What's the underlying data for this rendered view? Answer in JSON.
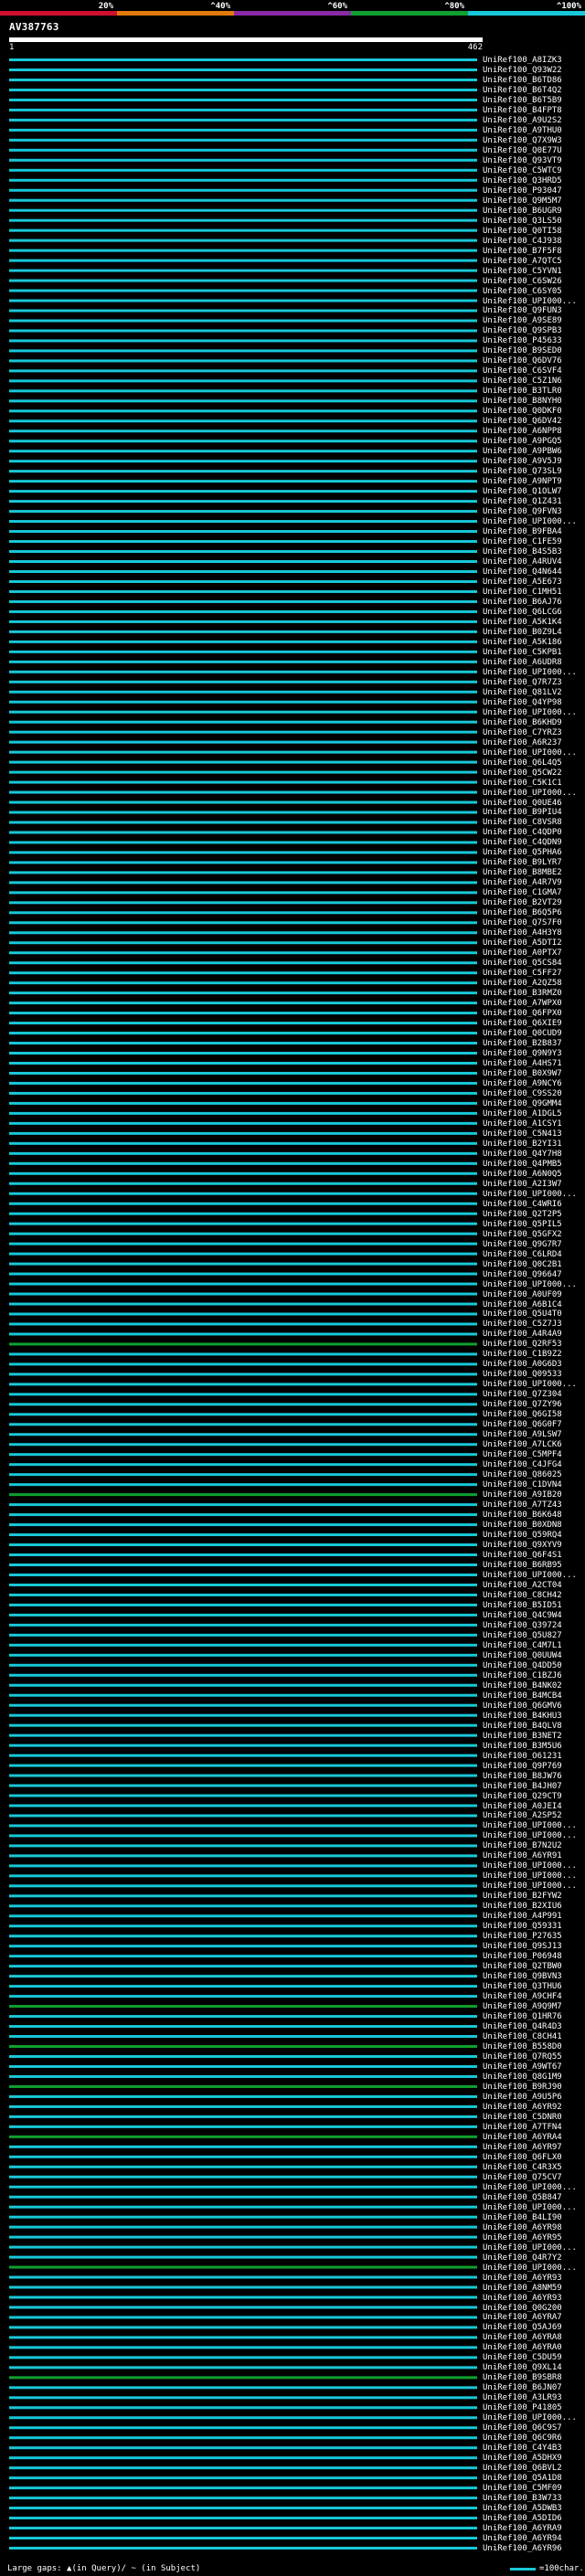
{
  "legend": {
    "segments": [
      {
        "label": "20%",
        "color": "#d0102e"
      },
      {
        "label": "^40%",
        "color": "#e07a0a"
      },
      {
        "label": "^60%",
        "color": "#8a2aa6"
      },
      {
        "label": "^80%",
        "color": "#10a030"
      },
      {
        "label": "^100%",
        "color": "#18c8d8"
      }
    ]
  },
  "query": {
    "title": "AV387763",
    "ruler_start": "1",
    "ruler_end": "462"
  },
  "hits": [
    {
      "label": "UniRef100_A8IZK3",
      "color": "#18c8d8"
    },
    {
      "label": "UniRef100_Q93W22",
      "color": "#18c8d8"
    },
    {
      "label": "UniRef100_B6TD86",
      "color": "#18c8d8"
    },
    {
      "label": "UniRef100_B6T4Q2",
      "color": "#18c8d8"
    },
    {
      "label": "UniRef100_B6T5B9",
      "color": "#18c8d8"
    },
    {
      "label": "UniRef100_B4FPT8",
      "color": "#18c8d8"
    },
    {
      "label": "UniRef100_A9U2S2",
      "color": "#18c8d8"
    },
    {
      "label": "UniRef100_A9THU0",
      "color": "#18c8d8"
    },
    {
      "label": "UniRef100_Q7X9W3",
      "color": "#18c8d8"
    },
    {
      "label": "UniRef100_Q0E77U",
      "color": "#18c8d8"
    },
    {
      "label": "UniRef100_Q93VT9",
      "color": "#18c8d8"
    },
    {
      "label": "UniRef100_C5WTC9",
      "color": "#18c8d8"
    },
    {
      "label": "UniRef100_Q3HRD5",
      "color": "#18c8d8"
    },
    {
      "label": "UniRef100_P93047",
      "color": "#18c8d8"
    },
    {
      "label": "UniRef100_Q9M5M7",
      "color": "#18c8d8"
    },
    {
      "label": "UniRef100_B6UGR9",
      "color": "#18c8d8"
    },
    {
      "label": "UniRef100_Q3LS50",
      "color": "#18c8d8"
    },
    {
      "label": "UniRef100_Q0TI58",
      "color": "#18c8d8"
    },
    {
      "label": "UniRef100_C4J938",
      "color": "#18c8d8"
    },
    {
      "label": "UniRef100_B7F5F8",
      "color": "#18c8d8"
    },
    {
      "label": "UniRef100_A7QTC5",
      "color": "#18c8d8"
    },
    {
      "label": "UniRef100_C5YVN1",
      "color": "#18c8d8"
    },
    {
      "label": "UniRef100_C6SW26",
      "color": "#18c8d8"
    },
    {
      "label": "UniRef100_C6SY05",
      "color": "#18c8d8"
    },
    {
      "label": "UniRef100_UPI000...",
      "color": "#18c8d8"
    },
    {
      "label": "UniRef100_Q9FUN3",
      "color": "#18c8d8"
    },
    {
      "label": "UniRef100_A9SE89",
      "color": "#18c8d8"
    },
    {
      "label": "UniRef100_Q9SPB3",
      "color": "#18c8d8"
    },
    {
      "label": "UniRef100_P45633",
      "color": "#18c8d8"
    },
    {
      "label": "UniRef100_B9SED0",
      "color": "#18c8d8"
    },
    {
      "label": "UniRef100_Q6DV76",
      "color": "#18c8d8"
    },
    {
      "label": "UniRef100_C6SVF4",
      "color": "#18c8d8"
    },
    {
      "label": "UniRef100_C5Z1N6",
      "color": "#18c8d8"
    },
    {
      "label": "UniRef100_B3TLR0",
      "color": "#18c8d8"
    },
    {
      "label": "UniRef100_B8NYH0",
      "color": "#18c8d8"
    },
    {
      "label": "UniRef100_Q0DKF0",
      "color": "#18c8d8"
    },
    {
      "label": "UniRef100_Q6DV42",
      "color": "#18c8d8"
    },
    {
      "label": "UniRef100_A6NPP8",
      "color": "#18c8d8"
    },
    {
      "label": "UniRef100_A9PGQ5",
      "color": "#18c8d8"
    },
    {
      "label": "UniRef100_A9PBW6",
      "color": "#18c8d8"
    },
    {
      "label": "UniRef100_A9V5J9",
      "color": "#18c8d8"
    },
    {
      "label": "UniRef100_Q73SL9",
      "color": "#18c8d8"
    },
    {
      "label": "UniRef100_A9NPT9",
      "color": "#18c8d8"
    },
    {
      "label": "UniRef100_Q1OLW7",
      "color": "#18c8d8"
    },
    {
      "label": "UniRef100_Q1Z431",
      "color": "#18c8d8"
    },
    {
      "label": "UniRef100_Q9FVN3",
      "color": "#18c8d8"
    },
    {
      "label": "UniRef100_UPI000...",
      "color": "#18c8d8"
    },
    {
      "label": "UniRef100_B9FBA4",
      "color": "#18c8d8"
    },
    {
      "label": "UniRef100_C1FE59",
      "color": "#18c8d8"
    },
    {
      "label": "UniRef100_B4S5B3",
      "color": "#18c8d8"
    },
    {
      "label": "UniRef100_A4RUV4",
      "color": "#18c8d8"
    },
    {
      "label": "UniRef100_Q4N644",
      "color": "#18c8d8"
    },
    {
      "label": "UniRef100_A5E673",
      "color": "#18c8d8"
    },
    {
      "label": "UniRef100_C1MH51",
      "color": "#18c8d8"
    },
    {
      "label": "UniRef100_B6AJ76",
      "color": "#18c8d8"
    },
    {
      "label": "UniRef100_Q6LCG6",
      "color": "#18c8d8"
    },
    {
      "label": "UniRef100_A5K1K4",
      "color": "#18c8d8"
    },
    {
      "label": "UniRef100_B0Z9L4",
      "color": "#18c8d8"
    },
    {
      "label": "UniRef100_A5K186",
      "color": "#18c8d8"
    },
    {
      "label": "UniRef100_C5KPB1",
      "color": "#18c8d8"
    },
    {
      "label": "UniRef100_A6UDR8",
      "color": "#18c8d8"
    },
    {
      "label": "UniRef100_UPI000...",
      "color": "#18c8d8"
    },
    {
      "label": "UniRef100_Q7R7Z3",
      "color": "#18c8d8"
    },
    {
      "label": "UniRef100_Q81LV2",
      "color": "#18c8d8"
    },
    {
      "label": "UniRef100_Q4YP98",
      "color": "#18c8d8"
    },
    {
      "label": "UniRef100_UPI000...",
      "color": "#18c8d8"
    },
    {
      "label": "UniRef100_B6KHD9",
      "color": "#18c8d8"
    },
    {
      "label": "UniRef100_C7YRZ3",
      "color": "#18c8d8"
    },
    {
      "label": "UniRef100_A6R237",
      "color": "#18c8d8"
    },
    {
      "label": "UniRef100_UPI000...",
      "color": "#18c8d8"
    },
    {
      "label": "UniRef100_Q6L4Q5",
      "color": "#18c8d8"
    },
    {
      "label": "UniRef100_Q5CW22",
      "color": "#18c8d8"
    },
    {
      "label": "UniRef100_C5K1C1",
      "color": "#18c8d8"
    },
    {
      "label": "UniRef100_UPI000...",
      "color": "#18c8d8"
    },
    {
      "label": "UniRef100_Q0UE46",
      "color": "#18c8d8"
    },
    {
      "label": "UniRef100_B9PIU4",
      "color": "#18c8d8"
    },
    {
      "label": "UniRef100_C8VSR8",
      "color": "#18c8d8"
    },
    {
      "label": "UniRef100_C4QDP0",
      "color": "#18c8d8"
    },
    {
      "label": "UniRef100_C4QDN9",
      "color": "#18c8d8"
    },
    {
      "label": "UniRef100_Q5PHA6",
      "color": "#18c8d8"
    },
    {
      "label": "UniRef100_B9LYR7",
      "color": "#18c8d8"
    },
    {
      "label": "UniRef100_B8MBE2",
      "color": "#18c8d8"
    },
    {
      "label": "UniRef100_A4R7V9",
      "color": "#18c8d8"
    },
    {
      "label": "UniRef100_C1GMA7",
      "color": "#18c8d8"
    },
    {
      "label": "UniRef100_B2VT29",
      "color": "#18c8d8"
    },
    {
      "label": "UniRef100_B6Q5P6",
      "color": "#18c8d8"
    },
    {
      "label": "UniRef100_Q7S7F0",
      "color": "#18c8d8"
    },
    {
      "label": "UniRef100_A4H3Y8",
      "color": "#18c8d8"
    },
    {
      "label": "UniRef100_A5DTI2",
      "color": "#18c8d8"
    },
    {
      "label": "UniRef100_A0PTX7",
      "color": "#18c8d8"
    },
    {
      "label": "UniRef100_Q5CS84",
      "color": "#18c8d8"
    },
    {
      "label": "UniRef100_C5FF27",
      "color": "#18c8d8"
    },
    {
      "label": "UniRef100_A2QZ58",
      "color": "#18c8d8"
    },
    {
      "label": "UniRef100_B3RMZ0",
      "color": "#18c8d8"
    },
    {
      "label": "UniRef100_A7WPX0",
      "color": "#18c8d8"
    },
    {
      "label": "UniRef100_Q6FPX0",
      "color": "#18c8d8"
    },
    {
      "label": "UniRef100_Q6XIE9",
      "color": "#18c8d8"
    },
    {
      "label": "UniRef100_Q0CUD9",
      "color": "#18c8d8"
    },
    {
      "label": "UniRef100_B2B837",
      "color": "#18c8d8"
    },
    {
      "label": "UniRef100_Q9N9Y3",
      "color": "#18c8d8"
    },
    {
      "label": "UniRef100_A4HS71",
      "color": "#18c8d8"
    },
    {
      "label": "UniRef100_B0X9W7",
      "color": "#18c8d8"
    },
    {
      "label": "UniRef100_A9NCY6",
      "color": "#18c8d8"
    },
    {
      "label": "UniRef100_C9SS20",
      "color": "#18c8d8"
    },
    {
      "label": "UniRef100_Q9GMM4",
      "color": "#18c8d8"
    },
    {
      "label": "UniRef100_A1DGL5",
      "color": "#18c8d8"
    },
    {
      "label": "UniRef100_A1CSY1",
      "color": "#18c8d8"
    },
    {
      "label": "UniRef100_C5N413",
      "color": "#18c8d8"
    },
    {
      "label": "UniRef100_B2YI31",
      "color": "#18c8d8"
    },
    {
      "label": "UniRef100_Q4Y7H8",
      "color": "#18c8d8"
    },
    {
      "label": "UniRef100_Q4PMB5",
      "color": "#18c8d8"
    },
    {
      "label": "UniRef100_A6N0Q5",
      "color": "#18c8d8"
    },
    {
      "label": "UniRef100_A2I3W7",
      "color": "#18c8d8"
    },
    {
      "label": "UniRef100_UPI000...",
      "color": "#18c8d8"
    },
    {
      "label": "UniRef100_C4WRI6",
      "color": "#18c8d8"
    },
    {
      "label": "UniRef100_Q2T2P5",
      "color": "#18c8d8"
    },
    {
      "label": "UniRef100_Q5PIL5",
      "color": "#18c8d8"
    },
    {
      "label": "UniRef100_Q5GFX2",
      "color": "#18c8d8"
    },
    {
      "label": "UniRef100_Q9G7R7",
      "color": "#18c8d8"
    },
    {
      "label": "UniRef100_C6LRD4",
      "color": "#18c8d8"
    },
    {
      "label": "UniRef100_Q0C2B1",
      "color": "#18c8d8"
    },
    {
      "label": "UniRef100_Q96647",
      "color": "#18c8d8"
    },
    {
      "label": "UniRef100_UPI000...",
      "color": "#18c8d8"
    },
    {
      "label": "UniRef100_A0UF09",
      "color": "#18c8d8"
    },
    {
      "label": "UniRef100_A6B1C4",
      "color": "#18c8d8"
    },
    {
      "label": "UniRef100_Q5U4T0",
      "color": "#18c8d8"
    },
    {
      "label": "UniRef100_C5Z7J3",
      "color": "#18c8d8"
    },
    {
      "label": "UniRef100_A4R4A9",
      "color": "#18c8d8"
    },
    {
      "label": "UniRef100_Q2RF53",
      "color": "#10a030"
    },
    {
      "label": "UniRef100_C1B9Z2",
      "color": "#18c8d8"
    },
    {
      "label": "UniRef100_A0G6D3",
      "color": "#18c8d8"
    },
    {
      "label": "UniRef100_Q09533",
      "color": "#18c8d8"
    },
    {
      "label": "UniRef100_UPI000...",
      "color": "#18c8d8"
    },
    {
      "label": "UniRef100_Q7Z304",
      "color": "#18c8d8"
    },
    {
      "label": "UniRef100_Q7ZY96",
      "color": "#18c8d8"
    },
    {
      "label": "UniRef100_Q6GI58",
      "color": "#18c8d8"
    },
    {
      "label": "UniRef100_Q6G0F7",
      "color": "#18c8d8"
    },
    {
      "label": "UniRef100_A9LSW7",
      "color": "#18c8d8"
    },
    {
      "label": "UniRef100_A7LCK6",
      "color": "#18c8d8"
    },
    {
      "label": "UniRef100_C5MPF4",
      "color": "#18c8d8"
    },
    {
      "label": "UniRef100_C4JFG4",
      "color": "#18c8d8"
    },
    {
      "label": "UniRef100_Q86025",
      "color": "#18c8d8"
    },
    {
      "label": "UniRef100_C1DVN4",
      "color": "#18c8d8"
    },
    {
      "label": "UniRef100_A9IB20",
      "color": "#10a030"
    },
    {
      "label": "UniRef100_A7TZ43",
      "color": "#18c8d8"
    },
    {
      "label": "UniRef100_B6K648",
      "color": "#18c8d8"
    },
    {
      "label": "UniRef100_B0XDN8",
      "color": "#18c8d8"
    },
    {
      "label": "UniRef100_Q59RQ4",
      "color": "#18c8d8"
    },
    {
      "label": "UniRef100_Q9XYV9",
      "color": "#18c8d8"
    },
    {
      "label": "UniRef100_Q6F4S1",
      "color": "#18c8d8"
    },
    {
      "label": "UniRef100_B6RB95",
      "color": "#18c8d8"
    },
    {
      "label": "UniRef100_UPI000...",
      "color": "#18c8d8"
    },
    {
      "label": "UniRef100_A2CT04",
      "color": "#18c8d8"
    },
    {
      "label": "UniRef100_C8CH42",
      "color": "#18c8d8"
    },
    {
      "label": "UniRef100_B5ID51",
      "color": "#18c8d8"
    },
    {
      "label": "UniRef100_Q4C9W4",
      "color": "#18c8d8"
    },
    {
      "label": "UniRef100_Q39724",
      "color": "#18c8d8"
    },
    {
      "label": "UniRef100_Q5U827",
      "color": "#18c8d8"
    },
    {
      "label": "UniRef100_C4M7L1",
      "color": "#18c8d8"
    },
    {
      "label": "UniRef100_Q0UUW4",
      "color": "#18c8d8"
    },
    {
      "label": "UniRef100_Q4DD50",
      "color": "#18c8d8"
    },
    {
      "label": "UniRef100_C1BZJ6",
      "color": "#18c8d8"
    },
    {
      "label": "UniRef100_B4NK02",
      "color": "#18c8d8"
    },
    {
      "label": "UniRef100_B4MCB4",
      "color": "#18c8d8"
    },
    {
      "label": "UniRef100_Q6GMV6",
      "color": "#18c8d8"
    },
    {
      "label": "UniRef100_B4KHU3",
      "color": "#18c8d8"
    },
    {
      "label": "UniRef100_B4QLV8",
      "color": "#18c8d8"
    },
    {
      "label": "UniRef100_B3NET2",
      "color": "#18c8d8"
    },
    {
      "label": "UniRef100_B3M5U6",
      "color": "#18c8d8"
    },
    {
      "label": "UniRef100_O61231",
      "color": "#18c8d8"
    },
    {
      "label": "UniRef100_Q9P769",
      "color": "#18c8d8"
    },
    {
      "label": "UniRef100_B8JW76",
      "color": "#18c8d8"
    },
    {
      "label": "UniRef100_B4JH07",
      "color": "#18c8d8"
    },
    {
      "label": "UniRef100_Q29CT9",
      "color": "#18c8d8"
    },
    {
      "label": "UniRef100_A0JEI4",
      "color": "#18c8d8"
    },
    {
      "label": "UniRef100_A2SP52",
      "color": "#18c8d8"
    },
    {
      "label": "UniRef100_UPI000...",
      "color": "#18c8d8"
    },
    {
      "label": "UniRef100_UPI000...",
      "color": "#18c8d8"
    },
    {
      "label": "UniRef100_B7N2U2",
      "color": "#18c8d8"
    },
    {
      "label": "UniRef100_A6YR91",
      "color": "#18c8d8"
    },
    {
      "label": "UniRef100_UPI000...",
      "color": "#18c8d8"
    },
    {
      "label": "UniRef100_UPI000...",
      "color": "#18c8d8"
    },
    {
      "label": "UniRef100_UPI000...",
      "color": "#18c8d8"
    },
    {
      "label": "UniRef100_B2FYW2",
      "color": "#18c8d8"
    },
    {
      "label": "UniRef100_B2XIU6",
      "color": "#18c8d8"
    },
    {
      "label": "UniRef100_A4P991",
      "color": "#18c8d8"
    },
    {
      "label": "UniRef100_Q59331",
      "color": "#18c8d8"
    },
    {
      "label": "UniRef100_P27635",
      "color": "#18c8d8"
    },
    {
      "label": "UniRef100_Q9SJ13",
      "color": "#18c8d8"
    },
    {
      "label": "UniRef100_P06948",
      "color": "#18c8d8"
    },
    {
      "label": "UniRef100_Q2TBW0",
      "color": "#18c8d8"
    },
    {
      "label": "UniRef100_Q9BVN3",
      "color": "#18c8d8"
    },
    {
      "label": "UniRef100_Q3THU6",
      "color": "#18c8d8"
    },
    {
      "label": "UniRef100_A9CHF4",
      "color": "#18c8d8"
    },
    {
      "label": "UniRef100_A9Q9M7",
      "color": "#10a030"
    },
    {
      "label": "UniRef100_Q1HR76",
      "color": "#18c8d8"
    },
    {
      "label": "UniRef100_Q4R4D3",
      "color": "#18c8d8"
    },
    {
      "label": "UniRef100_C8CH41",
      "color": "#18c8d8"
    },
    {
      "label": "UniRef100_B558D0",
      "color": "#10a030"
    },
    {
      "label": "UniRef100_Q7RQ55",
      "color": "#18c8d8"
    },
    {
      "label": "UniRef100_A9WT67",
      "color": "#18c8d8"
    },
    {
      "label": "UniRef100_Q8G1M9",
      "color": "#18c8d8"
    },
    {
      "label": "UniRef100_B9RJ90",
      "color": "#10a030"
    },
    {
      "label": "UniRef100_A9U5P6",
      "color": "#18c8d8"
    },
    {
      "label": "UniRef100_A6YR92",
      "color": "#18c8d8"
    },
    {
      "label": "UniRef100_C5DNR0",
      "color": "#18c8d8"
    },
    {
      "label": "UniRef100_A7TFN4",
      "color": "#18c8d8"
    },
    {
      "label": "UniRef100_A6YRA4",
      "color": "#10a030"
    },
    {
      "label": "UniRef100_A6YR97",
      "color": "#18c8d8"
    },
    {
      "label": "UniRef100_Q6FLX0",
      "color": "#18c8d8"
    },
    {
      "label": "UniRef100_C4R3X5",
      "color": "#18c8d8"
    },
    {
      "label": "UniRef100_Q75CV7",
      "color": "#18c8d8"
    },
    {
      "label": "UniRef100_UPI000...",
      "color": "#18c8d8"
    },
    {
      "label": "UniRef100_Q5B847",
      "color": "#18c8d8"
    },
    {
      "label": "UniRef100_UPI000...",
      "color": "#18c8d8"
    },
    {
      "label": "UniRef100_B4LI90",
      "color": "#18c8d8"
    },
    {
      "label": "UniRef100_A6YR98",
      "color": "#18c8d8"
    },
    {
      "label": "UniRef100_A6YR95",
      "color": "#18c8d8"
    },
    {
      "label": "UniRef100_UPI000...",
      "color": "#18c8d8"
    },
    {
      "label": "UniRef100_Q4R7Y2",
      "color": "#18c8d8"
    },
    {
      "label": "UniRef100_UPI000...",
      "color": "#10a030"
    },
    {
      "label": "UniRef100_A6YR93",
      "color": "#18c8d8"
    },
    {
      "label": "UniRef100_A8NM59",
      "color": "#18c8d8"
    },
    {
      "label": "UniRef100_A6YR93",
      "color": "#18c8d8"
    },
    {
      "label": "UniRef100_Q0G200",
      "color": "#18c8d8"
    },
    {
      "label": "UniRef100_A6YRA7",
      "color": "#18c8d8"
    },
    {
      "label": "UniRef100_Q5AJ69",
      "color": "#18c8d8"
    },
    {
      "label": "UniRef100_A6YRA8",
      "color": "#18c8d8"
    },
    {
      "label": "UniRef100_A6YRA0",
      "color": "#18c8d8"
    },
    {
      "label": "UniRef100_C5DU59",
      "color": "#18c8d8"
    },
    {
      "label": "UniRef100_Q9XL14",
      "color": "#18c8d8"
    },
    {
      "label": "UniRef100_B9SBR8",
      "color": "#10a030"
    },
    {
      "label": "UniRef100_B6JN07",
      "color": "#18c8d8"
    },
    {
      "label": "UniRef100_A3LR93",
      "color": "#18c8d8"
    },
    {
      "label": "UniRef100_P41805",
      "color": "#18c8d8"
    },
    {
      "label": "UniRef100_UPI000...",
      "color": "#18c8d8"
    },
    {
      "label": "UniRef100_Q6C9S7",
      "color": "#18c8d8"
    },
    {
      "label": "UniRef100_Q6C9R6",
      "color": "#18c8d8"
    },
    {
      "label": "UniRef100_C4Y4B3",
      "color": "#18c8d8"
    },
    {
      "label": "UniRef100_A5DHX9",
      "color": "#18c8d8"
    },
    {
      "label": "UniRef100_Q6BVL2",
      "color": "#18c8d8"
    },
    {
      "label": "UniRef100_Q5A1D8",
      "color": "#18c8d8"
    },
    {
      "label": "UniRef100_C5MF09",
      "color": "#18c8d8"
    },
    {
      "label": "UniRef100_B3W733",
      "color": "#18c8d8"
    },
    {
      "label": "UniRef100_A5DWB3",
      "color": "#18c8d8"
    },
    {
      "label": "UniRef100_A5DID6",
      "color": "#18c8d8"
    },
    {
      "label": "UniRef100_A6YRA9",
      "color": "#18c8d8"
    },
    {
      "label": "UniRef100_A6YR94",
      "color": "#18c8d8"
    },
    {
      "label": "UniRef100_A6YR96",
      "color": "#18c8d8"
    }
  ],
  "footer": {
    "gaps_text": "Large gaps: ▲(in Query)/ ~ (in Subject)",
    "scale_text": "=100char."
  }
}
